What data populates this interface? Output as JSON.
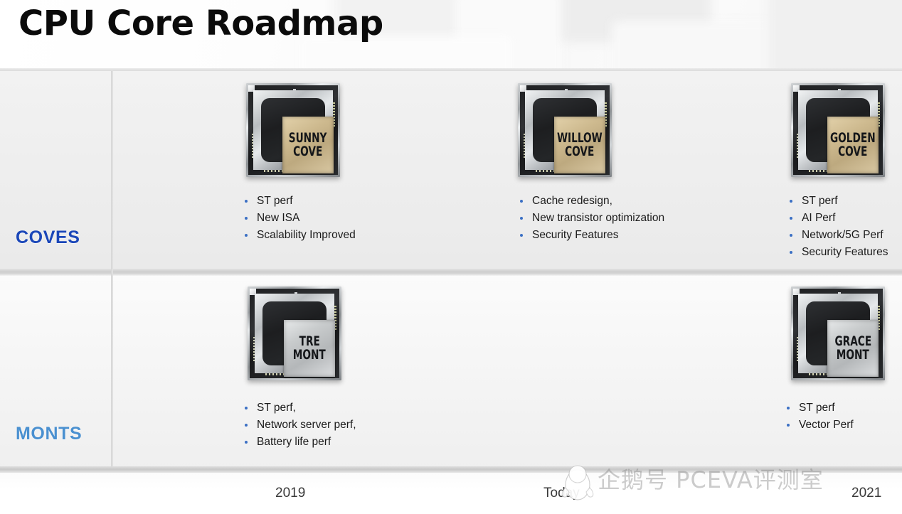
{
  "slide": {
    "title": "CPU Core Roadmap",
    "accent_blue_dark": "#1a46b8",
    "accent_blue_light": "#4a90d0",
    "bullet_dot_color": "#3a6fc4"
  },
  "rows": [
    {
      "label": "COVES",
      "label_color": "#1a46b8",
      "chips": [
        {
          "name_line1": "SUNNY",
          "name_line2": "COVE",
          "die_style": "gold",
          "bullets": [
            "ST perf",
            "New ISA",
            "Scalability Improved"
          ]
        },
        {
          "name_line1": "WILLOW",
          "name_line2": "COVE",
          "die_style": "gold",
          "bullets": [
            "Cache redesign,",
            "New transistor optimization",
            "Security Features"
          ]
        },
        {
          "name_line1": "GOLDEN",
          "name_line2": "COVE",
          "die_style": "gold",
          "bullets": [
            "ST perf",
            "AI Perf",
            "Network/5G Perf",
            "Security Features"
          ]
        }
      ]
    },
    {
      "label": "MONTS",
      "label_color": "#4a90d0",
      "chips": [
        {
          "name_line1": "TRE",
          "name_line2": "MONT",
          "die_style": "silver",
          "bullets": [
            "ST perf,",
            "Network server perf,",
            "Battery life perf"
          ]
        },
        {
          "name_line1": "GRACE",
          "name_line2": "MONT",
          "die_style": "silver",
          "bullets": [
            "ST perf",
            "Vector Perf"
          ]
        }
      ]
    }
  ],
  "timeline": {
    "labels": [
      "2019",
      "Today",
      "2021"
    ]
  },
  "watermark": {
    "text": "企鹅号 PCEVA评测室",
    "logo": "penguin-icon"
  }
}
